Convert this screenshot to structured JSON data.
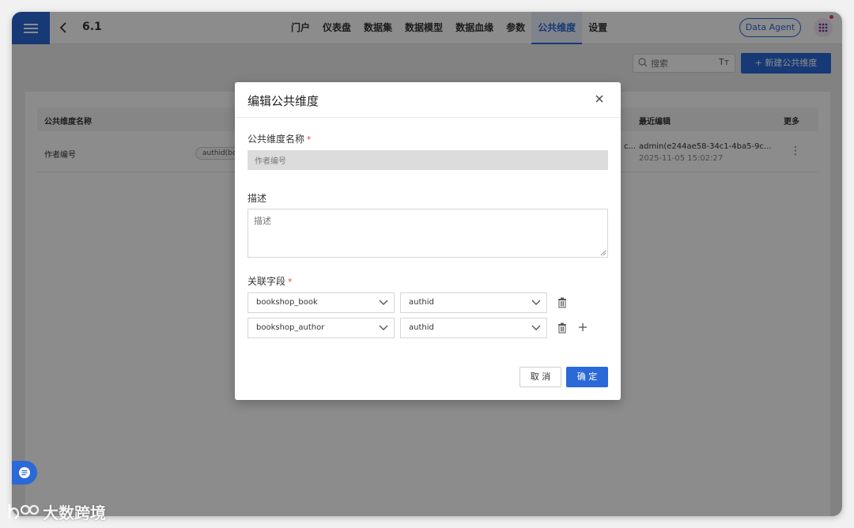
{
  "header": {
    "title": "6.1",
    "nav": [
      "门户",
      "仪表盘",
      "数据集",
      "数据模型",
      "数据血缘",
      "参数",
      "公共维度",
      "设置"
    ],
    "active_nav": "公共维度",
    "agent_label": "Data Agent"
  },
  "toolbar": {
    "search_placeholder": "搜索",
    "font_icon_text": "Tт",
    "new_label": "+ 新建公共维度"
  },
  "table": {
    "columns": [
      "公共维度名称",
      "最近编辑",
      "更多"
    ],
    "rows": [
      {
        "name": "作者编号",
        "tag": "authid(bo",
        "truncated_cell": "c...",
        "editor": "admin(e244ae58-34c1-4ba5-9c...",
        "time": "2025-11-05 15:02:27"
      }
    ]
  },
  "modal": {
    "title": "编辑公共维度",
    "name_label": "公共维度名称",
    "name_value": "作者编号",
    "desc_label": "描述",
    "desc_placeholder": "描述",
    "fields_label": "关联字段",
    "fields": [
      {
        "table": "bookshop_book",
        "column": "authid"
      },
      {
        "table": "bookshop_author",
        "column": "authid"
      }
    ],
    "cancel_label": "取 消",
    "ok_label": "确 定"
  },
  "watermark": {
    "text": "大数跨境"
  },
  "colors": {
    "accent": "#2b68d8",
    "required": "#e54444"
  }
}
